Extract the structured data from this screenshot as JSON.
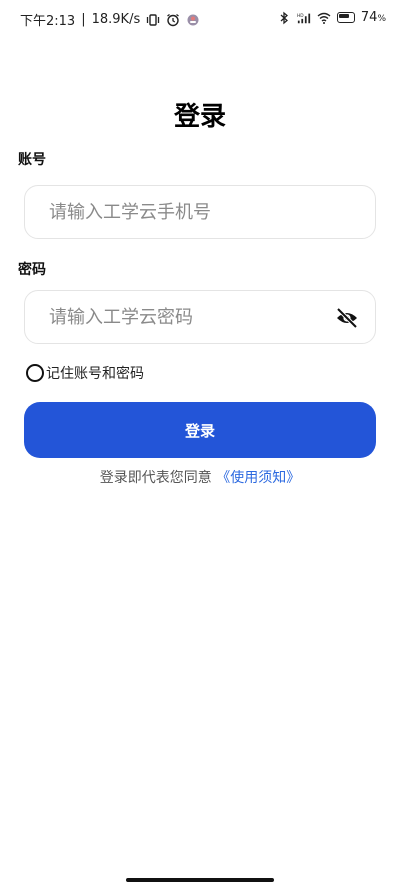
{
  "status_bar": {
    "time": "下午2:13",
    "network_speed": "18.9K/s",
    "battery_percent": "74",
    "battery_unit": "%",
    "icons_left": [
      "vibrate-icon",
      "alarm-icon",
      "app-notification-icon"
    ],
    "icons_right": [
      "bluetooth-icon",
      "signal-hd-icon",
      "wifi-icon",
      "battery-icon"
    ]
  },
  "page": {
    "title": "登录"
  },
  "account": {
    "label": "账号",
    "placeholder": "请输入工学云手机号",
    "value": ""
  },
  "password": {
    "label": "密码",
    "placeholder": "请输入工学云密码",
    "value": "",
    "visibility_icon": "eye-off-icon"
  },
  "remember": {
    "label": "记住账号和密码",
    "checked": false
  },
  "login_button": {
    "label": "登录",
    "color": "#2355d8"
  },
  "agreement": {
    "prefix": "登录即代表您同意",
    "link": "《使用须知》",
    "link_color": "#2d6ae0"
  }
}
